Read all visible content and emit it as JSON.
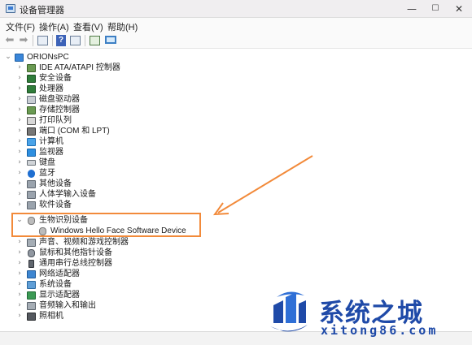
{
  "window": {
    "title": "设备管理器",
    "controls": {
      "minimize": "—",
      "maximize": "☐",
      "close": "✕"
    }
  },
  "menu": {
    "file": "文件(F)",
    "action": "操作(A)",
    "view": "查看(V)",
    "help": "帮助(H)"
  },
  "toolbar": {
    "back_glyph": "⬅",
    "forward_glyph": "➡",
    "help_glyph": "?",
    "icons": [
      "back-icon",
      "forward-icon",
      "properties-icon",
      "help-icon",
      "update-driver-icon",
      "scan-hardware-icon",
      "monitor-icon"
    ]
  },
  "tree": {
    "expanded_glyph": "⌄",
    "collapsed_glyph": "›",
    "root": "ORIONsPC",
    "categories": [
      "IDE ATA/ATAPI 控制器",
      "安全设备",
      "处理器",
      "磁盘驱动器",
      "存储控制器",
      "打印队列",
      "端口 (COM 和 LPT)",
      "计算机",
      "监视器",
      "键盘",
      "蓝牙",
      "其他设备",
      "人体学输入设备",
      "软件设备",
      "生物识别设备",
      "Windows Hello Face Software Device",
      "声音、视频和游戏控制器",
      "鼠标和其他指针设备",
      "通用串行总线控制器",
      "网络适配器",
      "系统设备",
      "显示适配器",
      "音频输入和输出",
      "照相机"
    ]
  },
  "annotation": {
    "color": "#f28a3a"
  },
  "watermark": {
    "text": "系统之城",
    "url": "xitong86.com",
    "color": "#1f4aa8"
  }
}
